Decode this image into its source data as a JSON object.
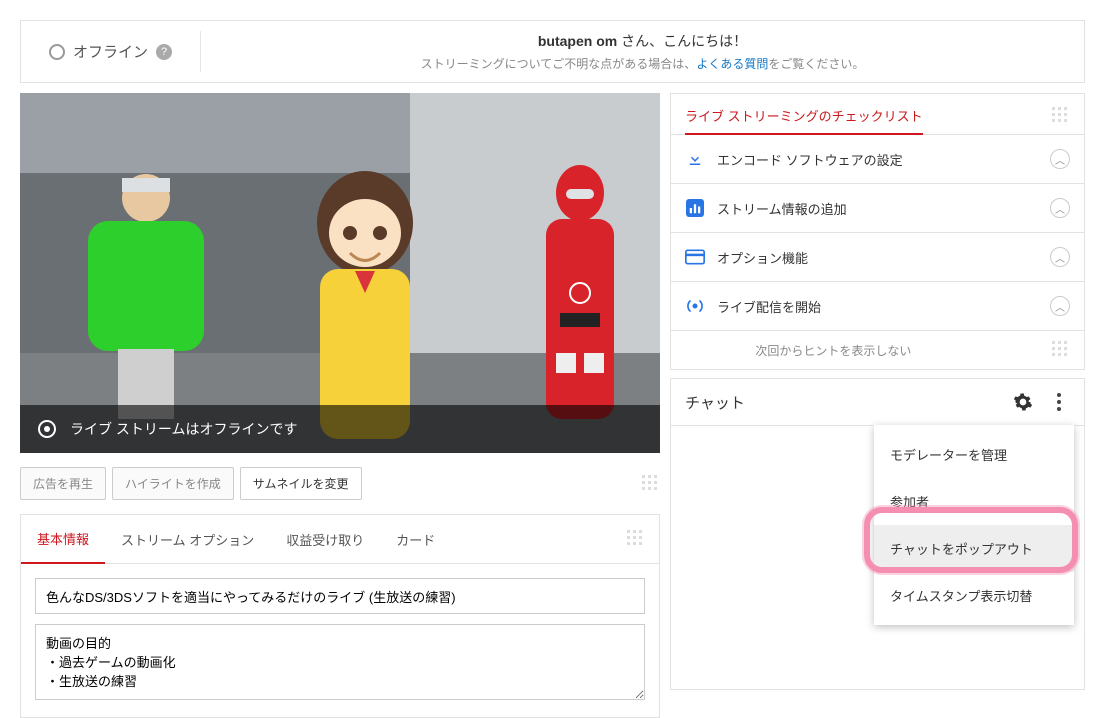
{
  "header": {
    "status_label": "オフライン",
    "welcome_prefix": "butapen om",
    "welcome_suffix": " さん、こんにちは！",
    "sub_prefix": "ストリーミングについてご不明な点がある場合は、",
    "faq_link": "よくある質問",
    "sub_suffix": "をご覧ください。"
  },
  "video": {
    "overlay_text": "ライブ ストリームはオフラインです"
  },
  "actions": {
    "replay_ads": "広告を再生",
    "create_highlight": "ハイライトを作成",
    "change_thumbnail": "サムネイルを変更"
  },
  "tabs": {
    "basic": "基本情報",
    "stream_options": "ストリーム オプション",
    "monetization": "収益受け取り",
    "cards": "カード"
  },
  "form": {
    "title_value": "色んなDS/3DSソフトを適当にやってみるだけのライブ (生放送の練習)",
    "description_value": "動画の目的\n・過去ゲームの動画化\n・生放送の練習"
  },
  "checklist": {
    "title": "ライブ ストリーミングのチェックリスト",
    "items": [
      {
        "icon": "download",
        "label": "エンコード ソフトウェアの設定"
      },
      {
        "icon": "bars",
        "label": "ストリーム情報の追加"
      },
      {
        "icon": "card",
        "label": "オプション機能"
      },
      {
        "icon": "live",
        "label": "ライブ配信を開始"
      }
    ],
    "hint": "次回からヒントを表示しない"
  },
  "chat": {
    "title": "チャット",
    "menu": {
      "moderators": "モデレーターを管理",
      "participants": "参加者",
      "popout": "チャットをポップアウト",
      "timestamp": "タイムスタンプ表示切替"
    }
  }
}
